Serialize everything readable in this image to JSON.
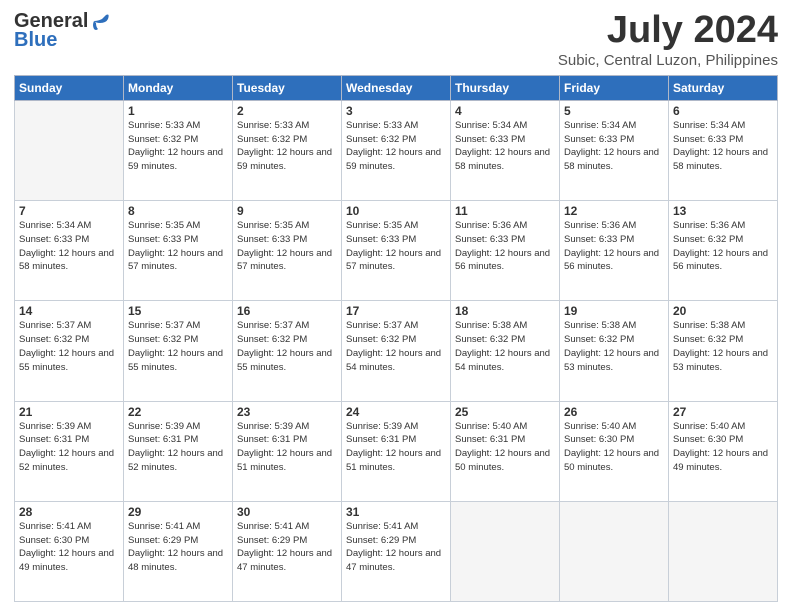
{
  "header": {
    "logo_general": "General",
    "logo_blue": "Blue",
    "main_title": "July 2024",
    "subtitle": "Subic, Central Luzon, Philippines"
  },
  "calendar": {
    "weekdays": [
      "Sunday",
      "Monday",
      "Tuesday",
      "Wednesday",
      "Thursday",
      "Friday",
      "Saturday"
    ],
    "weeks": [
      [
        {
          "day": "",
          "sunrise": "",
          "sunset": "",
          "daylight": ""
        },
        {
          "day": "1",
          "sunrise": "Sunrise: 5:33 AM",
          "sunset": "Sunset: 6:32 PM",
          "daylight": "Daylight: 12 hours and 59 minutes."
        },
        {
          "day": "2",
          "sunrise": "Sunrise: 5:33 AM",
          "sunset": "Sunset: 6:32 PM",
          "daylight": "Daylight: 12 hours and 59 minutes."
        },
        {
          "day": "3",
          "sunrise": "Sunrise: 5:33 AM",
          "sunset": "Sunset: 6:32 PM",
          "daylight": "Daylight: 12 hours and 59 minutes."
        },
        {
          "day": "4",
          "sunrise": "Sunrise: 5:34 AM",
          "sunset": "Sunset: 6:33 PM",
          "daylight": "Daylight: 12 hours and 58 minutes."
        },
        {
          "day": "5",
          "sunrise": "Sunrise: 5:34 AM",
          "sunset": "Sunset: 6:33 PM",
          "daylight": "Daylight: 12 hours and 58 minutes."
        },
        {
          "day": "6",
          "sunrise": "Sunrise: 5:34 AM",
          "sunset": "Sunset: 6:33 PM",
          "daylight": "Daylight: 12 hours and 58 minutes."
        }
      ],
      [
        {
          "day": "7",
          "sunrise": "Sunrise: 5:34 AM",
          "sunset": "Sunset: 6:33 PM",
          "daylight": "Daylight: 12 hours and 58 minutes."
        },
        {
          "day": "8",
          "sunrise": "Sunrise: 5:35 AM",
          "sunset": "Sunset: 6:33 PM",
          "daylight": "Daylight: 12 hours and 57 minutes."
        },
        {
          "day": "9",
          "sunrise": "Sunrise: 5:35 AM",
          "sunset": "Sunset: 6:33 PM",
          "daylight": "Daylight: 12 hours and 57 minutes."
        },
        {
          "day": "10",
          "sunrise": "Sunrise: 5:35 AM",
          "sunset": "Sunset: 6:33 PM",
          "daylight": "Daylight: 12 hours and 57 minutes."
        },
        {
          "day": "11",
          "sunrise": "Sunrise: 5:36 AM",
          "sunset": "Sunset: 6:33 PM",
          "daylight": "Daylight: 12 hours and 56 minutes."
        },
        {
          "day": "12",
          "sunrise": "Sunrise: 5:36 AM",
          "sunset": "Sunset: 6:33 PM",
          "daylight": "Daylight: 12 hours and 56 minutes."
        },
        {
          "day": "13",
          "sunrise": "Sunrise: 5:36 AM",
          "sunset": "Sunset: 6:32 PM",
          "daylight": "Daylight: 12 hours and 56 minutes."
        }
      ],
      [
        {
          "day": "14",
          "sunrise": "Sunrise: 5:37 AM",
          "sunset": "Sunset: 6:32 PM",
          "daylight": "Daylight: 12 hours and 55 minutes."
        },
        {
          "day": "15",
          "sunrise": "Sunrise: 5:37 AM",
          "sunset": "Sunset: 6:32 PM",
          "daylight": "Daylight: 12 hours and 55 minutes."
        },
        {
          "day": "16",
          "sunrise": "Sunrise: 5:37 AM",
          "sunset": "Sunset: 6:32 PM",
          "daylight": "Daylight: 12 hours and 55 minutes."
        },
        {
          "day": "17",
          "sunrise": "Sunrise: 5:37 AM",
          "sunset": "Sunset: 6:32 PM",
          "daylight": "Daylight: 12 hours and 54 minutes."
        },
        {
          "day": "18",
          "sunrise": "Sunrise: 5:38 AM",
          "sunset": "Sunset: 6:32 PM",
          "daylight": "Daylight: 12 hours and 54 minutes."
        },
        {
          "day": "19",
          "sunrise": "Sunrise: 5:38 AM",
          "sunset": "Sunset: 6:32 PM",
          "daylight": "Daylight: 12 hours and 53 minutes."
        },
        {
          "day": "20",
          "sunrise": "Sunrise: 5:38 AM",
          "sunset": "Sunset: 6:32 PM",
          "daylight": "Daylight: 12 hours and 53 minutes."
        }
      ],
      [
        {
          "day": "21",
          "sunrise": "Sunrise: 5:39 AM",
          "sunset": "Sunset: 6:31 PM",
          "daylight": "Daylight: 12 hours and 52 minutes."
        },
        {
          "day": "22",
          "sunrise": "Sunrise: 5:39 AM",
          "sunset": "Sunset: 6:31 PM",
          "daylight": "Daylight: 12 hours and 52 minutes."
        },
        {
          "day": "23",
          "sunrise": "Sunrise: 5:39 AM",
          "sunset": "Sunset: 6:31 PM",
          "daylight": "Daylight: 12 hours and 51 minutes."
        },
        {
          "day": "24",
          "sunrise": "Sunrise: 5:39 AM",
          "sunset": "Sunset: 6:31 PM",
          "daylight": "Daylight: 12 hours and 51 minutes."
        },
        {
          "day": "25",
          "sunrise": "Sunrise: 5:40 AM",
          "sunset": "Sunset: 6:31 PM",
          "daylight": "Daylight: 12 hours and 50 minutes."
        },
        {
          "day": "26",
          "sunrise": "Sunrise: 5:40 AM",
          "sunset": "Sunset: 6:30 PM",
          "daylight": "Daylight: 12 hours and 50 minutes."
        },
        {
          "day": "27",
          "sunrise": "Sunrise: 5:40 AM",
          "sunset": "Sunset: 6:30 PM",
          "daylight": "Daylight: 12 hours and 49 minutes."
        }
      ],
      [
        {
          "day": "28",
          "sunrise": "Sunrise: 5:41 AM",
          "sunset": "Sunset: 6:30 PM",
          "daylight": "Daylight: 12 hours and 49 minutes."
        },
        {
          "day": "29",
          "sunrise": "Sunrise: 5:41 AM",
          "sunset": "Sunset: 6:29 PM",
          "daylight": "Daylight: 12 hours and 48 minutes."
        },
        {
          "day": "30",
          "sunrise": "Sunrise: 5:41 AM",
          "sunset": "Sunset: 6:29 PM",
          "daylight": "Daylight: 12 hours and 47 minutes."
        },
        {
          "day": "31",
          "sunrise": "Sunrise: 5:41 AM",
          "sunset": "Sunset: 6:29 PM",
          "daylight": "Daylight: 12 hours and 47 minutes."
        },
        {
          "day": "",
          "sunrise": "",
          "sunset": "",
          "daylight": ""
        },
        {
          "day": "",
          "sunrise": "",
          "sunset": "",
          "daylight": ""
        },
        {
          "day": "",
          "sunrise": "",
          "sunset": "",
          "daylight": ""
        }
      ]
    ]
  }
}
